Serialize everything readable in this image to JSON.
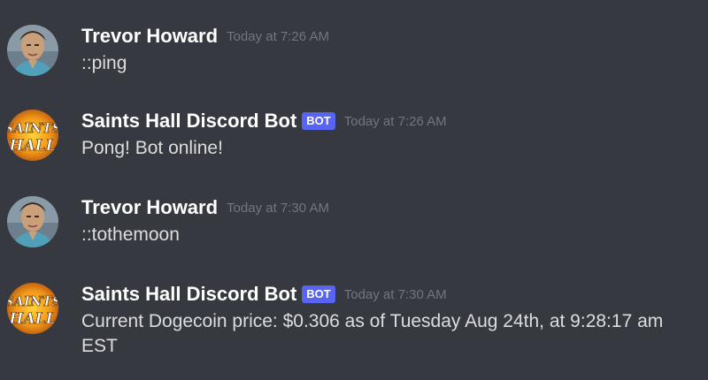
{
  "messages": [
    {
      "author": "Trevor Howard",
      "avatar_icon": "user-portrait-icon",
      "is_bot": false,
      "timestamp": "Today at 7:26 AM",
      "content": "::ping"
    },
    {
      "author": "Saints Hall Discord Bot",
      "avatar_icon": "saints-hall-logo-icon",
      "is_bot": true,
      "bot_label": "BOT",
      "timestamp": "Today at 7:26 AM",
      "content": "Pong! Bot online!"
    },
    {
      "author": "Trevor Howard",
      "avatar_icon": "user-portrait-icon",
      "is_bot": false,
      "timestamp": "Today at 7:30 AM",
      "content": "::tothemoon"
    },
    {
      "author": "Saints Hall Discord Bot",
      "avatar_icon": "saints-hall-logo-icon",
      "is_bot": true,
      "bot_label": "BOT",
      "timestamp": "Today at 7:30 AM",
      "content": "Current Dogecoin price: $0.306 as of Tuesday Aug 24th, at 9:28:17 am EST"
    }
  ],
  "colors": {
    "background": "#36393f",
    "author": "#ffffff",
    "text": "#dcddde",
    "timestamp": "#72767d",
    "bot_tag": "#5865f2"
  },
  "logo_text": "SAINTS HALL"
}
